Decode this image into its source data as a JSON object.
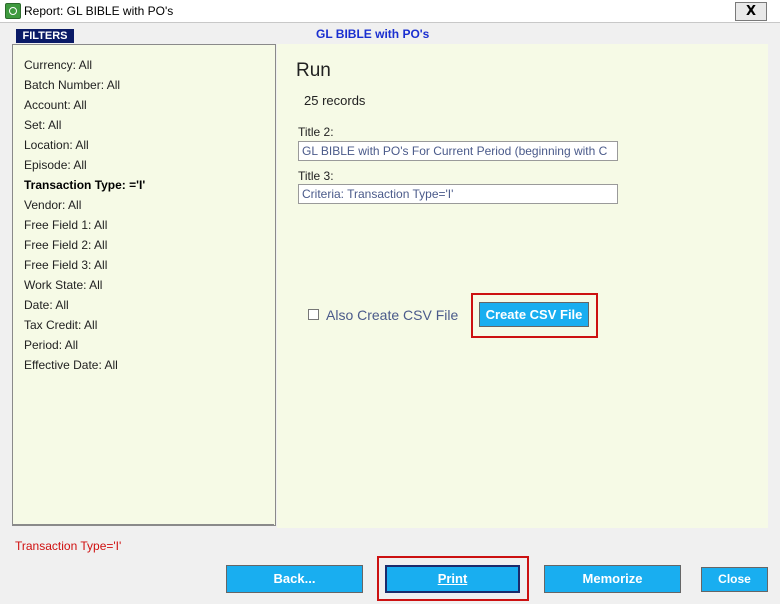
{
  "window": {
    "title": "Report: GL BIBLE with PO's",
    "close_glyph": "X"
  },
  "filters_tab": "FILTERS",
  "report_heading": "GL BIBLE with PO's",
  "filters": [
    {
      "label": "Currency: All",
      "bold": false
    },
    {
      "label": "Batch Number: All",
      "bold": false
    },
    {
      "label": "Account: All",
      "bold": false
    },
    {
      "label": "Set: All",
      "bold": false
    },
    {
      "label": "Location: All",
      "bold": false
    },
    {
      "label": "Episode: All",
      "bold": false
    },
    {
      "label": "Transaction Type: ='I'",
      "bold": true
    },
    {
      "label": "Vendor: All",
      "bold": false
    },
    {
      "label": "Free Field 1: All",
      "bold": false
    },
    {
      "label": "Free Field 2: All",
      "bold": false
    },
    {
      "label": "Free Field 3: All",
      "bold": false
    },
    {
      "label": "Work State: All",
      "bold": false
    },
    {
      "label": "Date: All",
      "bold": false
    },
    {
      "label": "Tax Credit: All",
      "bold": false
    },
    {
      "label": "Period: All",
      "bold": false
    },
    {
      "label": "Effective Date: All",
      "bold": false
    }
  ],
  "run": {
    "heading": "Run",
    "records": "25 records",
    "title2_label": "Title 2:",
    "title2_value": "GL BIBLE with PO's For Current Period (beginning with C",
    "title3_label": "Title 3:",
    "title3_value": "Criteria: Transaction Type='I'",
    "csv_checkbox_label": "Also Create CSV File",
    "csv_checked": false,
    "create_csv_button": "Create CSV File"
  },
  "criteria_text": "Transaction Type='I'",
  "buttons": {
    "back": "Back...",
    "print": "Print",
    "memorize": "Memorize",
    "close": "Close"
  },
  "colors": {
    "panel_bg": "#f6fae6",
    "button_bg": "#19aef0",
    "heading_blue": "#1a2fd0",
    "highlight_red": "#cc1111",
    "criteria_red": "#d01010"
  }
}
